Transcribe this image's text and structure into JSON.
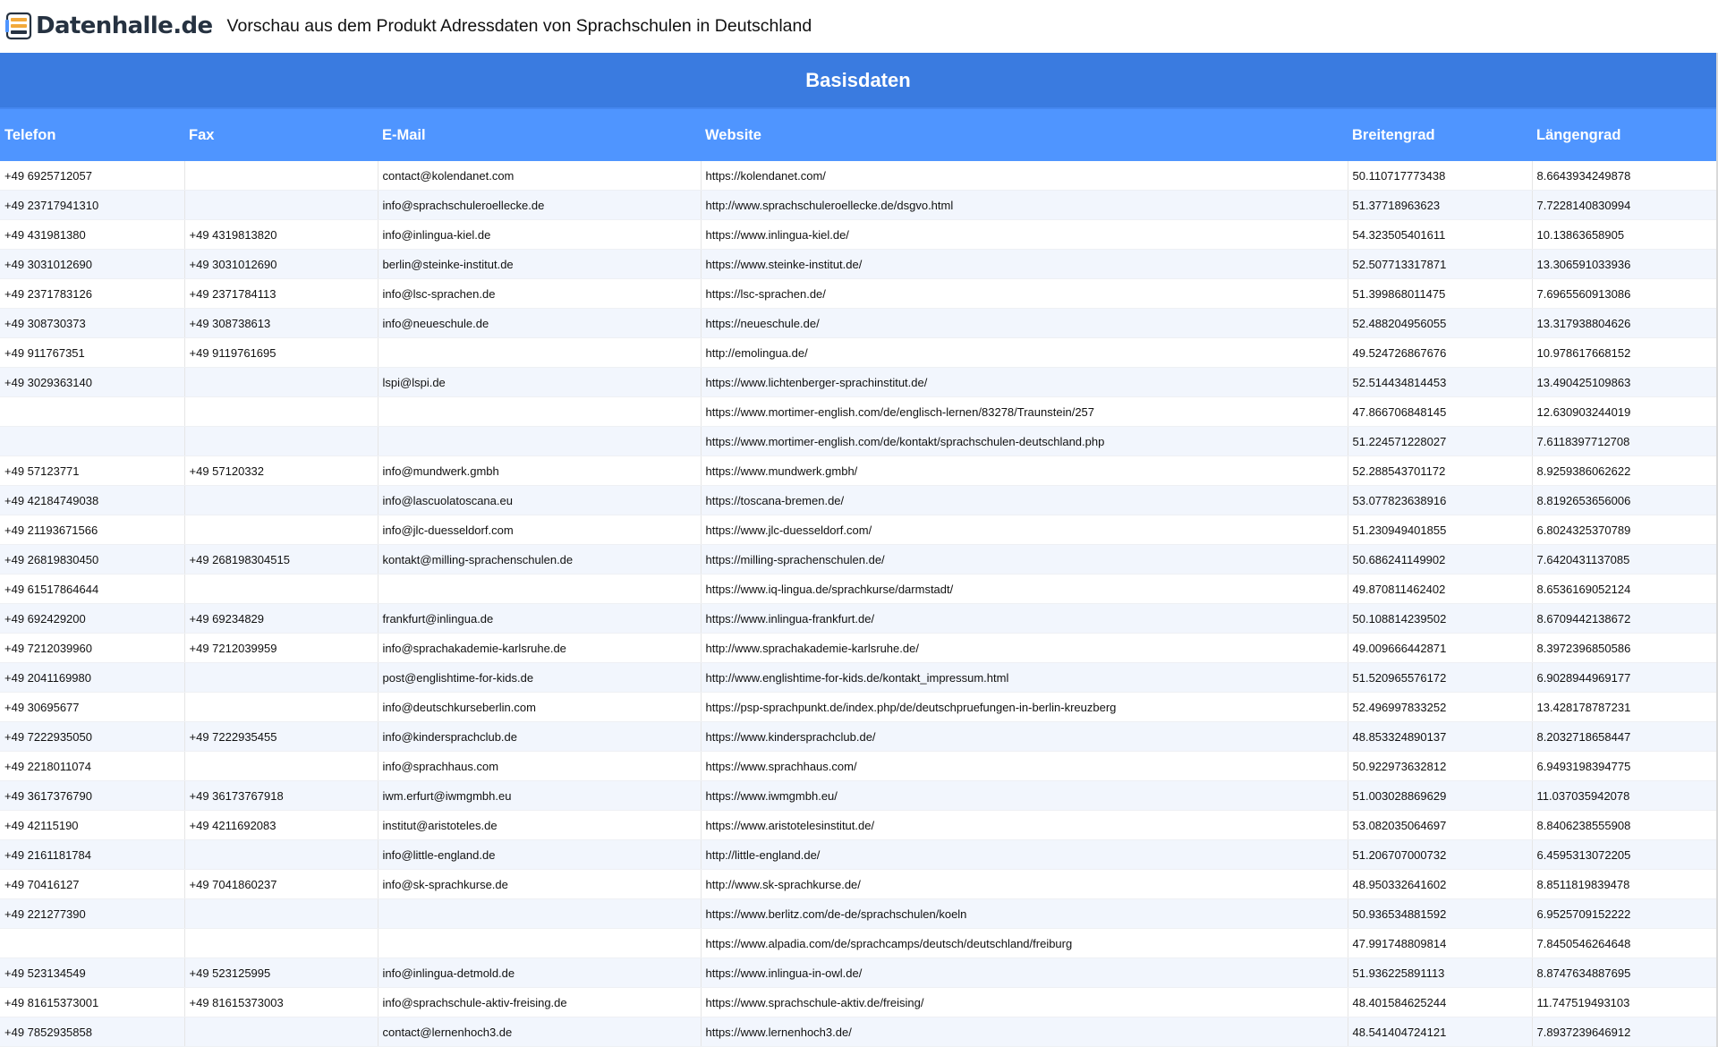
{
  "header": {
    "logo_text": "Datenhalle.de",
    "title": "Vorschau aus dem Produkt Adressdaten von Sprachschulen in Deutschland"
  },
  "section": {
    "title": "Basisdaten"
  },
  "table": {
    "columns": [
      "Telefon",
      "Fax",
      "E-Mail",
      "Website",
      "Breitengrad",
      "Längengrad"
    ],
    "rows": [
      [
        "+49 6925712057",
        "",
        "contact@kolendanet.com",
        "https://kolendanet.com/",
        "50.110717773438",
        "8.6643934249878"
      ],
      [
        "+49 23717941310",
        "",
        "info@sprachschuleroellecke.de",
        "http://www.sprachschuleroellecke.de/dsgvo.html",
        "51.37718963623",
        "7.7228140830994"
      ],
      [
        "+49 431981380",
        "+49 4319813820",
        "info@inlingua-kiel.de",
        "https://www.inlingua-kiel.de/",
        "54.323505401611",
        "10.13863658905"
      ],
      [
        "+49 3031012690",
        "+49 3031012690",
        "berlin@steinke-institut.de",
        "https://www.steinke-institut.de/",
        "52.507713317871",
        "13.306591033936"
      ],
      [
        "+49 2371783126",
        "+49 2371784113",
        "info@lsc-sprachen.de",
        "https://lsc-sprachen.de/",
        "51.399868011475",
        "7.6965560913086"
      ],
      [
        "+49 308730373",
        "+49 308738613",
        "info@neueschule.de",
        "https://neueschule.de/",
        "52.488204956055",
        "13.317938804626"
      ],
      [
        "+49 911767351",
        "+49 9119761695",
        "",
        "http://emolingua.de/",
        "49.524726867676",
        "10.978617668152"
      ],
      [
        "+49 3029363140",
        "",
        "lspi@lspi.de",
        "https://www.lichtenberger-sprachinstitut.de/",
        "52.514434814453",
        "13.490425109863"
      ],
      [
        "",
        "",
        "",
        "https://www.mortimer-english.com/de/englisch-lernen/83278/Traunstein/257",
        "47.866706848145",
        "12.630903244019"
      ],
      [
        "",
        "",
        "",
        "https://www.mortimer-english.com/de/kontakt/sprachschulen-deutschland.php",
        "51.224571228027",
        "7.6118397712708"
      ],
      [
        "+49 57123771",
        "+49 57120332",
        "info@mundwerk.gmbh",
        "https://www.mundwerk.gmbh/",
        "52.288543701172",
        "8.9259386062622"
      ],
      [
        "+49 42184749038",
        "",
        "info@lascuolatoscana.eu",
        "https://toscana-bremen.de/",
        "53.077823638916",
        "8.8192653656006"
      ],
      [
        "+49 21193671566",
        "",
        "info@jlc-duesseldorf.com",
        "https://www.jlc-duesseldorf.com/",
        "51.230949401855",
        "6.8024325370789"
      ],
      [
        "+49 26819830450",
        "+49 268198304515",
        "kontakt@milling-sprachenschulen.de",
        "https://milling-sprachenschulen.de/",
        "50.686241149902",
        "7.6420431137085"
      ],
      [
        "+49 61517864644",
        "",
        "",
        "https://www.iq-lingua.de/sprachkurse/darmstadt/",
        "49.870811462402",
        "8.6536169052124"
      ],
      [
        "+49 692429200",
        "+49 69234829",
        "frankfurt@inlingua.de",
        "https://www.inlingua-frankfurt.de/",
        "50.108814239502",
        "8.6709442138672"
      ],
      [
        "+49 7212039960",
        "+49 7212039959",
        "info@sprachakademie-karlsruhe.de",
        "http://www.sprachakademie-karlsruhe.de/",
        "49.009666442871",
        "8.3972396850586"
      ],
      [
        "+49 2041169980",
        "",
        "post@englishtime-for-kids.de",
        "http://www.englishtime-for-kids.de/kontakt_impressum.html",
        "51.520965576172",
        "6.9028944969177"
      ],
      [
        "+49 30695677",
        "",
        "info@deutschkurseberlin.com",
        "https://psp-sprachpunkt.de/index.php/de/deutschpruefungen-in-berlin-kreuzberg",
        "52.496997833252",
        "13.428178787231"
      ],
      [
        "+49 7222935050",
        "+49 7222935455",
        "info@kindersprachclub.de",
        "https://www.kindersprachclub.de/",
        "48.853324890137",
        "8.2032718658447"
      ],
      [
        "+49 2218011074",
        "",
        "info@sprachhaus.com",
        "https://www.sprachhaus.com/",
        "50.922973632812",
        "6.9493198394775"
      ],
      [
        "+49 3617376790",
        "+49 36173767918",
        "iwm.erfurt@iwmgmbh.eu",
        "https://www.iwmgmbh.eu/",
        "51.003028869629",
        "11.037035942078"
      ],
      [
        "+49 42115190",
        "+49 4211692083",
        "institut@aristoteles.de",
        "https://www.aristotelesinstitut.de/",
        "53.082035064697",
        "8.8406238555908"
      ],
      [
        "+49 2161181784",
        "",
        "info@little-england.de",
        "http://little-england.de/",
        "51.206707000732",
        "6.4595313072205"
      ],
      [
        "+49 70416127",
        "+49 7041860237",
        "info@sk-sprachkurse.de",
        "http://www.sk-sprachkurse.de/",
        "48.950332641602",
        "8.8511819839478"
      ],
      [
        "+49 221277390",
        "",
        "",
        "https://www.berlitz.com/de-de/sprachschulen/koeln",
        "50.936534881592",
        "6.9525709152222"
      ],
      [
        "",
        "",
        "",
        "https://www.alpadia.com/de/sprachcamps/deutsch/deutschland/freiburg",
        "47.991748809814",
        "7.8450546264648"
      ],
      [
        "+49 523134549",
        "+49 523125995",
        "info@inlingua-detmold.de",
        "https://www.inlingua-in-owl.de/",
        "51.936225891113",
        "8.8747634887695"
      ],
      [
        "+49 81615373001",
        "+49 81615373003",
        "info@sprachschule-aktiv-freising.de",
        "https://www.sprachschule-aktiv.de/freising/",
        "48.401584625244",
        "11.747519493103"
      ],
      [
        "+49 7852935858",
        "",
        "contact@lernenhoch3.de",
        "https://www.lernenhoch3.de/",
        "48.541404724121",
        "7.8937239646912"
      ],
      [
        "",
        "",
        "",
        "",
        "",
        ""
      ]
    ]
  }
}
